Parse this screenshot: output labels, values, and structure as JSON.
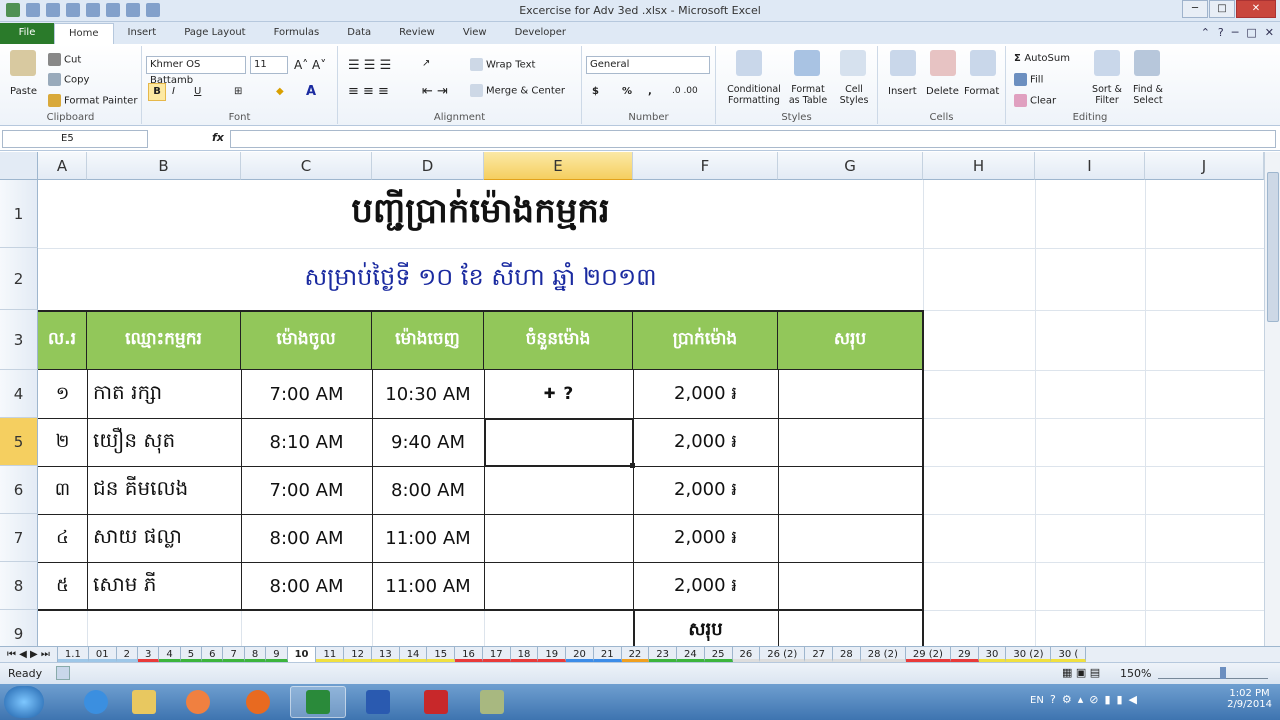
{
  "window": {
    "title": "Excercise for Adv 3ed .xlsx - Microsoft Excel"
  },
  "tabs": [
    "File",
    "Home",
    "Insert",
    "Page Layout",
    "Formulas",
    "Data",
    "Review",
    "View",
    "Developer"
  ],
  "ribbon": {
    "clipboard": {
      "paste": "Paste",
      "cut": "Cut",
      "copy": "Copy",
      "format_painter": "Format Painter",
      "label": "Clipboard"
    },
    "font": {
      "name": "Khmer OS Battamb",
      "size": "11",
      "label": "Font",
      "bold": "B",
      "italic": "I",
      "underline": "U"
    },
    "alignment": {
      "wrap": "Wrap Text",
      "merge": "Merge & Center",
      "label": "Alignment"
    },
    "number": {
      "format": "General",
      "label": "Number",
      "currency": "$",
      "percent": "%",
      "comma": ","
    },
    "styles": {
      "conditional": "Conditional Formatting",
      "format_table": "Format as Table",
      "cell_styles": "Cell Styles",
      "label": "Styles"
    },
    "cells": {
      "insert": "Insert",
      "delete": "Delete",
      "format": "Format",
      "label": "Cells"
    },
    "editing": {
      "autosum": "AutoSum",
      "fill": "Fill",
      "clear": "Clear",
      "sort": "Sort & Filter",
      "find": "Find & Select",
      "label": "Editing"
    }
  },
  "formula_bar": {
    "name_box": "E5",
    "fx": "fx"
  },
  "columns": [
    "A",
    "B",
    "C",
    "D",
    "E",
    "F",
    "G",
    "H",
    "I",
    "J"
  ],
  "rows": [
    "1",
    "2",
    "3",
    "4",
    "5",
    "6",
    "7",
    "8",
    "9"
  ],
  "sheet": {
    "title": "បញ្ជីប្រាក់ម៉ោងកម្មករ",
    "subtitle": "សម្រាប់ថ្ងៃទី ១០ ខែ សីហា ឆ្នាំ ២០១៣",
    "headers": [
      "ល.រ",
      "ឈ្មោះកម្មករ",
      "ម៉ោងចូល",
      "ម៉ោងចេញ",
      "ចំនួនម៉ោង",
      "ប្រាក់ម៉ោង",
      "សរុប"
    ],
    "data": [
      {
        "no": "១",
        "name": "កាត រក្សា",
        "in": "7:00 AM",
        "out": "10:30 AM",
        "hours": "?",
        "rate": "2,000 ៛"
      },
      {
        "no": "២",
        "name": "យឿន សុត",
        "in": "8:10 AM",
        "out": "9:40 AM",
        "hours": "",
        "rate": "2,000 ៛"
      },
      {
        "no": "៣",
        "name": "ជន គីមលេង",
        "in": "7:00 AM",
        "out": "8:00 AM",
        "hours": "",
        "rate": "2,000 ៛"
      },
      {
        "no": "៤",
        "name": "សាយ ផល្លា",
        "in": "8:00 AM",
        "out": "11:00 AM",
        "hours": "",
        "rate": "2,000 ៛"
      },
      {
        "no": "៥",
        "name": "សោម ភី",
        "in": "8:00 AM",
        "out": "11:00 AM",
        "hours": "",
        "rate": "2,000 ៛"
      }
    ],
    "total_label": "សរុប"
  },
  "sheet_tabs": [
    "1.1",
    "01",
    "2",
    "3",
    "4",
    "5",
    "6",
    "7",
    "8",
    "9",
    "10",
    "11",
    "12",
    "13",
    "14",
    "15",
    "16",
    "17",
    "18",
    "19",
    "20",
    "21",
    "22",
    "23",
    "24",
    "25",
    "26",
    "26 (2)",
    "27",
    "28",
    "28 (2)",
    "29 (2)",
    "29",
    "30",
    "30 (2)",
    "30 ("
  ],
  "sheet_tab_colors": [
    "#9ec7e8",
    "#9ec7e8",
    "#9ec7e8",
    "#e83a3a",
    "#3cb43c",
    "#3cb43c",
    "#3cb43c",
    "#3cb43c",
    "#3cb43c",
    "#3cb43c",
    "#ffffff",
    "#f0e040",
    "#f0e040",
    "#f0e040",
    "#f0e040",
    "#f0e040",
    "#e83a3a",
    "#e83a3a",
    "#e83a3a",
    "#e83a3a",
    "#3c8ce8",
    "#3c8ce8",
    "#f0a020",
    "#3cb43c",
    "#3cb43c",
    "#3cb43c",
    "#dddddd",
    "#dddddd",
    "#dddddd",
    "#dddddd",
    "#dddddd",
    "#e83a3a",
    "#e83a3a",
    "#f0e040",
    "#f0e040",
    "#f0e040"
  ],
  "status": {
    "ready": "Ready",
    "zoom": "150%"
  },
  "tray": {
    "lang": "EN",
    "time": "1:02 PM",
    "date": "2/9/2014"
  }
}
